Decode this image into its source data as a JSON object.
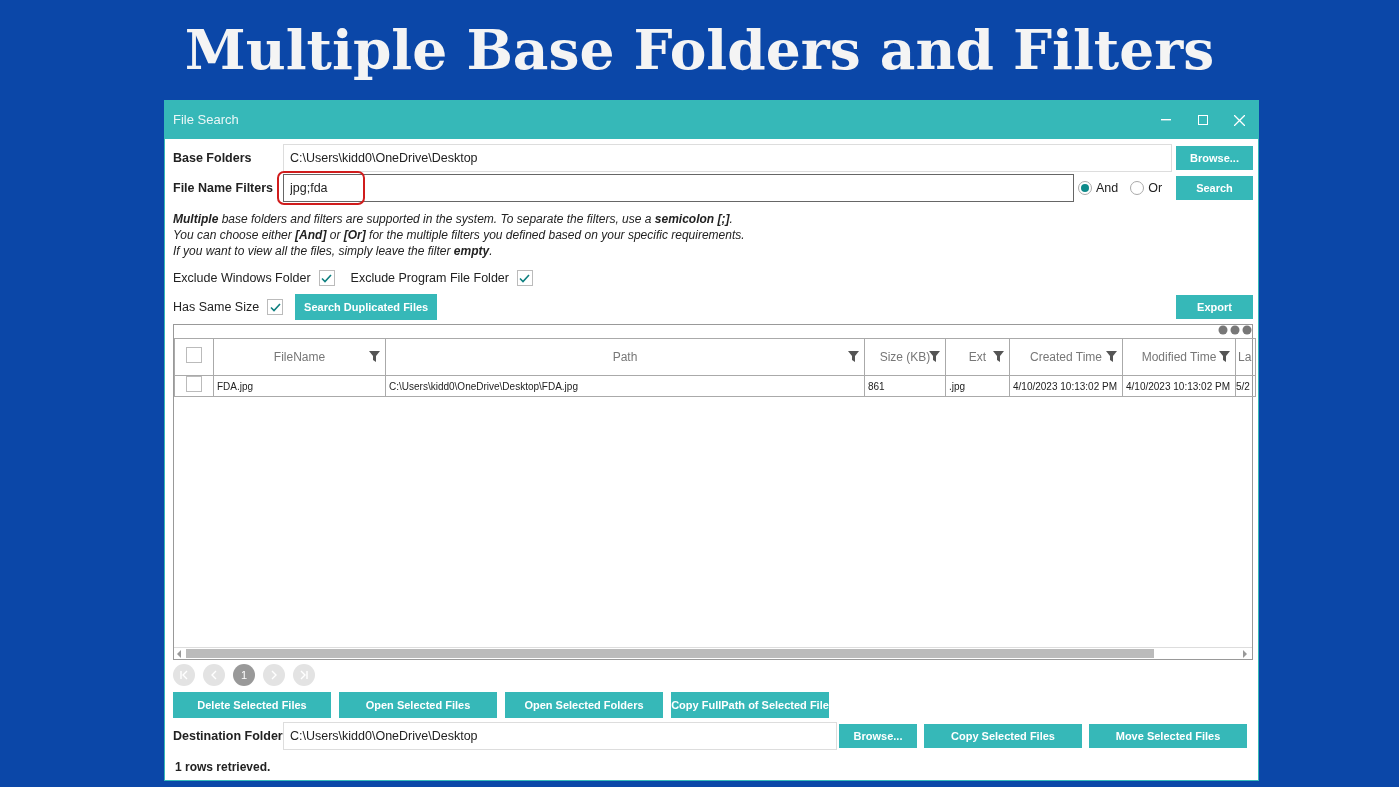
{
  "heading": "Multiple Base Folders and Filters",
  "window": {
    "title": "File Search"
  },
  "base_folders": {
    "label": "Base Folders",
    "value": "C:\\Users\\kidd0\\OneDrive\\Desktop",
    "button": "Browse..."
  },
  "file_name_filters": {
    "label": "File Name Filters",
    "value": "jpg;fda",
    "highlighted": true,
    "button": "Search"
  },
  "match_mode": [
    {
      "label": "And",
      "selected": true
    },
    {
      "label": "Or",
      "selected": false
    }
  ],
  "help_lines": [
    "**Multiple** base folders and filters are supported in the system. To separate the filters, use a **semicolon [;]**.",
    "You can choose either **[And]** or **[Or]** for the multiple filters you defined based on your specific requirements.",
    "If you want to view all the files, simply leave the filter **empty**."
  ],
  "options": [
    {
      "label": "Exclude Windows Folder",
      "checked": true
    },
    {
      "label": "Exclude Program File Folder",
      "checked": true
    }
  ],
  "same_size": {
    "label": "Has Same Size",
    "checked": true,
    "button": "Search Duplicated Files"
  },
  "export_button": "Export",
  "table": {
    "select_all": false,
    "columns": [
      {
        "label": "FileName",
        "filter": true
      },
      {
        "label": "Path",
        "filter": true
      },
      {
        "label": "Size (KB)",
        "filter": true
      },
      {
        "label": "Ext",
        "filter": true
      },
      {
        "label": "Created Time",
        "filter": true
      },
      {
        "label": "Modified Time",
        "filter": true
      },
      {
        "label": "La",
        "filter": false
      }
    ],
    "rows": [
      {
        "checked": false,
        "cells": [
          "FDA.jpg",
          "C:\\Users\\kidd0\\OneDrive\\Desktop\\FDA.jpg",
          "861",
          ".jpg",
          "4/10/2023 10:13:02 PM",
          "4/10/2023 10:13:02 PM",
          "5/2"
        ]
      }
    ]
  },
  "pager": {
    "pages": [
      {
        "label": "1",
        "selected": true
      }
    ]
  },
  "actions": [
    "Delete Selected Files",
    "Open Selected Files",
    "Open Selected Folders",
    "Copy FullPath of Selected File"
  ],
  "destination": {
    "label": "Destination Folder",
    "value": "C:\\Users\\kidd0\\OneDrive\\Desktop",
    "buttons": [
      "Browse...",
      "Copy Selected Files",
      "Move Selected Files"
    ]
  },
  "status": "1 rows retrieved."
}
